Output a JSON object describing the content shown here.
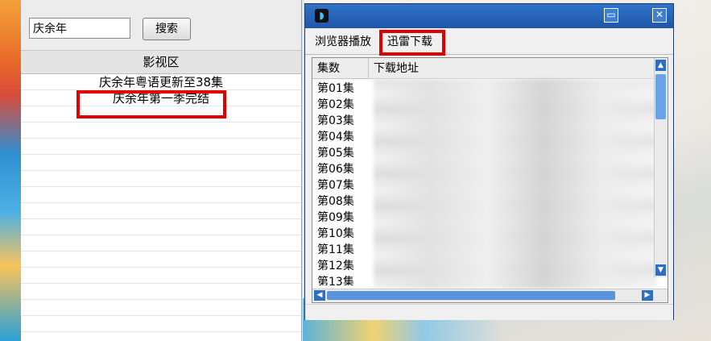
{
  "left": {
    "search_value": "庆余年",
    "search_button": "搜索",
    "list_header": "影视区",
    "items": [
      {
        "label": "庆余年粤语更新至38集"
      },
      {
        "label": "庆余年第一季完结"
      }
    ]
  },
  "download_window": {
    "tabs": [
      {
        "label": "浏览器播放"
      },
      {
        "label": "迅雷下载"
      }
    ],
    "active_tab": "迅雷下载",
    "columns": {
      "episode": "集数",
      "url": "下载地址"
    },
    "episodes": [
      "第01集",
      "第02集",
      "第03集",
      "第04集",
      "第05集",
      "第06集",
      "第07集",
      "第08集",
      "第09集",
      "第10集",
      "第11集",
      "第12集",
      "第13集"
    ],
    "url_cells_blurred": true
  },
  "colors": {
    "highlight": "#e10000",
    "title_bar": "#1f56a8"
  },
  "icons": {
    "app_icon": "app-icon",
    "minimize": "minimize-icon",
    "close": "close-icon",
    "scroll_up": "arrow-up-icon",
    "scroll_down": "arrow-down-icon",
    "scroll_left": "arrow-left-icon",
    "scroll_right": "arrow-right-icon"
  }
}
